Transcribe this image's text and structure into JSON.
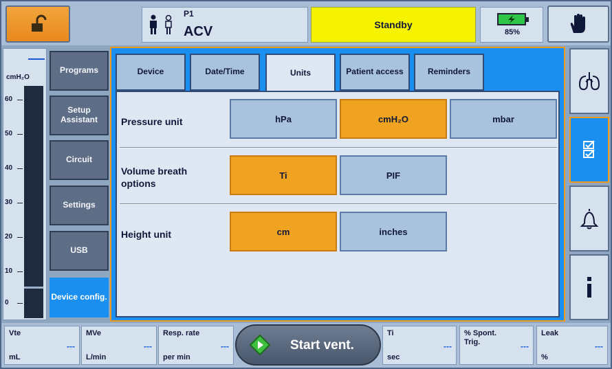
{
  "header": {
    "patient_id": "P1",
    "mode": "ACV",
    "status": "Standby",
    "battery": "85%"
  },
  "gauge": {
    "unit": "cmH₂O",
    "ticks": [
      "60",
      "50",
      "40",
      "30",
      "20",
      "10",
      "0"
    ]
  },
  "menu": [
    {
      "label": "Programs"
    },
    {
      "label": "Setup Assistant"
    },
    {
      "label": "Circuit"
    },
    {
      "label": "Settings"
    },
    {
      "label": "USB"
    },
    {
      "label": "Device config."
    }
  ],
  "tabs": [
    {
      "label": "Device"
    },
    {
      "label": "Date/Time"
    },
    {
      "label": "Units"
    },
    {
      "label": "Patient access"
    },
    {
      "label": "Reminders"
    }
  ],
  "units": {
    "pressure": {
      "label": "Pressure unit",
      "options": [
        "hPa",
        "cmH₂O",
        "mbar"
      ],
      "selected": "cmH₂O"
    },
    "volume": {
      "label": "Volume breath options",
      "options": [
        "Ti",
        "PIF"
      ],
      "selected": "Ti"
    },
    "height": {
      "label": "Height unit",
      "options": [
        "cm",
        "inches"
      ],
      "selected": "cm"
    }
  },
  "bottom": {
    "params": [
      {
        "label": "Vte",
        "unit": "mL",
        "value": "---"
      },
      {
        "label": "MVe",
        "unit": "L/min",
        "value": "---"
      },
      {
        "label": "Resp. rate",
        "unit": "per min",
        "value": "---"
      },
      {
        "label": "Ti",
        "unit": "sec",
        "value": "---"
      },
      {
        "label": "% Spont. Trig.",
        "unit": "",
        "value": "---"
      },
      {
        "label": "Leak",
        "unit": "%",
        "value": "---"
      }
    ],
    "start_label": "Start vent."
  },
  "colors": {
    "accent": "#1a8ff0",
    "selected": "#f0a320",
    "status": "#f6f300"
  },
  "icons": {
    "lock": "unlock-icon",
    "hand": "hand-icon",
    "lungs": "lungs-icon",
    "checklist": "checklist-icon",
    "alarm": "bell-icon",
    "info": "info-icon"
  }
}
